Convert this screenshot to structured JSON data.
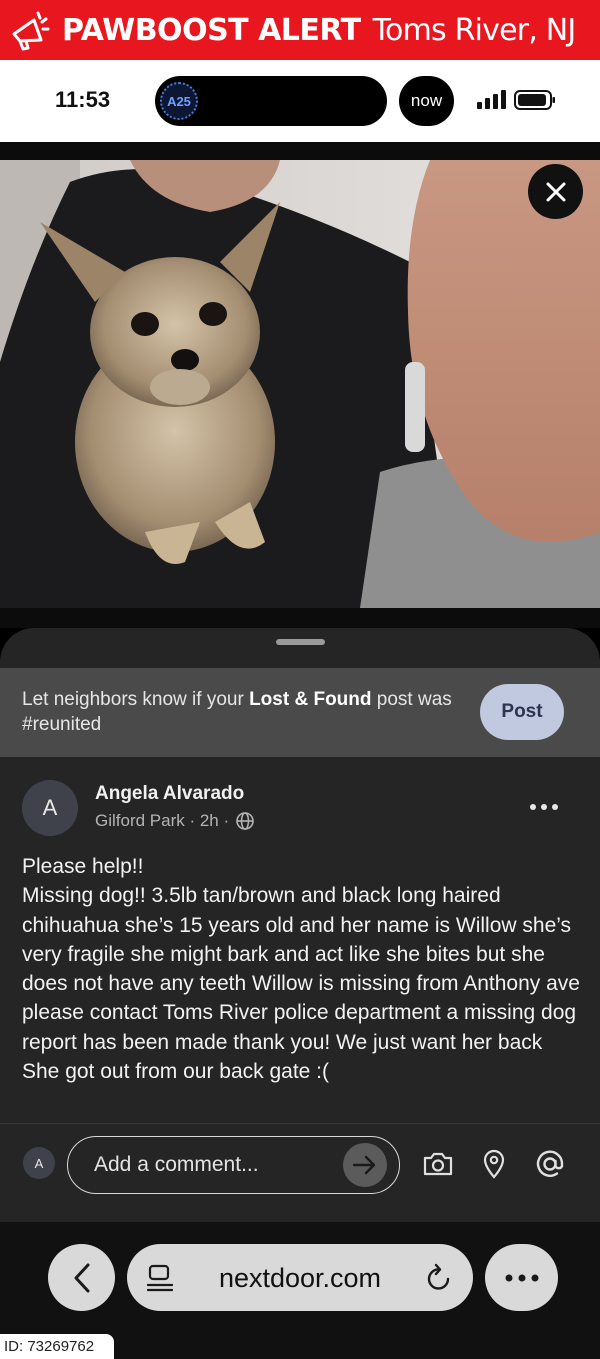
{
  "alert": {
    "brand": "PAWBOOST ALERT",
    "location": "Toms River, NJ",
    "icon": "megaphone-icon",
    "color": "#e8161f"
  },
  "status_bar": {
    "time": "11:53",
    "badge": "A25",
    "now_label": "now"
  },
  "photo": {
    "close_icon": "close-icon"
  },
  "reunite_banner": {
    "text_before": "Let neighbors know if your ",
    "text_bold": "Lost & Found",
    "text_after": " post was #reunited",
    "button_label": "Post"
  },
  "post": {
    "author_initial": "A",
    "author_name": "Angela Alvarado",
    "meta": "Gilford Park · 2h ·",
    "body": "Please help!!\nMissing  dog!! 3.5lb tan/brown and black long haired chihuahua she’s 15 years old and her name is Willow she’s very fragile she might bark and act like she bites but she does not have any teeth Willow is missing from Anthony ave please contact Toms River police department a missing dog report has been made thank you! We just want her back\nShe got out from our back gate :("
  },
  "comment": {
    "avatar_initial": "A",
    "placeholder": "Add a comment..."
  },
  "browser": {
    "url": "nextdoor.com"
  },
  "footer": {
    "id_label": "ID: 73269762"
  }
}
